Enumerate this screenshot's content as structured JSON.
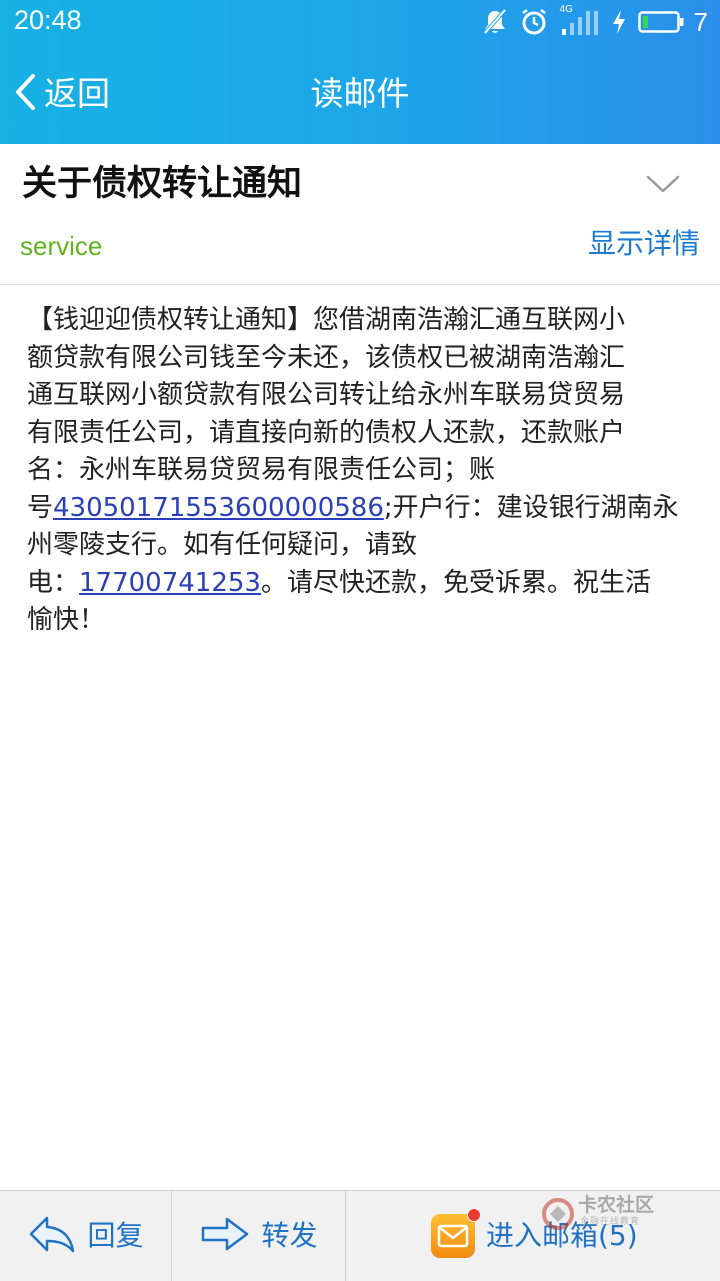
{
  "status_bar": {
    "time": "20:48",
    "network_label": "4G",
    "battery_level": "7",
    "icons": [
      "mute-icon",
      "alarm-icon",
      "signal-icon",
      "charging-icon",
      "battery-icon"
    ]
  },
  "app_bar": {
    "back_label": "返回",
    "title": "读邮件"
  },
  "mail": {
    "subject": "关于债权转让通知",
    "sender": "service",
    "show_details_label": "显示详情",
    "body": {
      "line1": "【钱迎迎债权转让通知】您借湖南浩瀚汇通互联网小",
      "line2": "额贷款有限公司钱至今未还，该债权已被湖南浩瀚汇",
      "line3": "通互联网小额贷款有限公司转让给永州车联易贷贸易",
      "line4": "有限责任公司，请直接向新的债权人还款，还款账户",
      "line5": "名：永州车联易贷贸易有限责任公司；账",
      "line6_prefix": "号",
      "account_number": "43050171553600000586",
      "line6_suffix": ";开户行：建设银行湖南永",
      "line7": "州零陵支行。如有任何疑问，请致",
      "line8_prefix": "电：",
      "phone_number": "17700741253",
      "line8_suffix": "。请尽快还款，免受诉累。祝生活",
      "line9": "愉快！"
    }
  },
  "bottom_bar": {
    "reply_label": "回复",
    "forward_label": "转发",
    "inbox_label": "进入邮箱(5)"
  },
  "watermark": {
    "text": "卡农社区",
    "subtext": "金融在线教育"
  },
  "colors": {
    "header_gradient_start": "#17b1e4",
    "header_gradient_end": "#2a8fea",
    "sender_green": "#62b21e",
    "link_blue": "#1c7bd1",
    "body_link": "#2a3fb8",
    "mailbox_orange": "#f6a21e"
  }
}
